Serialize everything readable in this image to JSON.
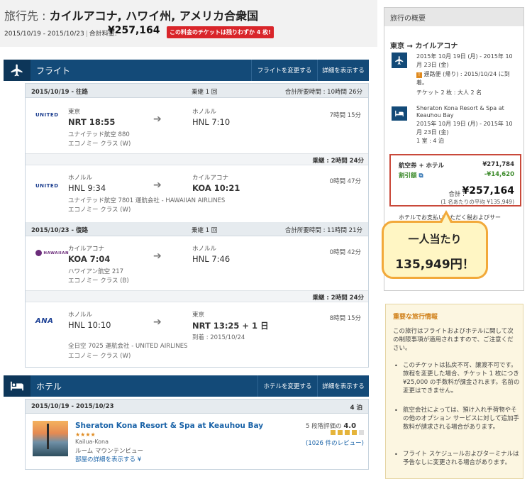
{
  "header": {
    "prefix": "旅行先 : ",
    "destination": "カイルアコナ, ハワイ州, アメリカ合衆国",
    "dates": "2015/10/19 - 2015/10/23",
    "total_label": "合計料金:",
    "total": "¥257,164",
    "badge": "この料金のチケットは残りわずか 4 枚!"
  },
  "flight_section": {
    "title": "フライト",
    "change_btn": "フライトを変更する",
    "details_btn": "詳細を表示する"
  },
  "outbound": {
    "date": "2015/10/19 - 往路",
    "stops": "乗継 1 回",
    "total_time": "合計所要時間 : 10時間 26分",
    "layover": "乗継 : 2時間 24分",
    "segments": [
      {
        "logo": "UNITED",
        "from_city": "東京",
        "from_time": "NRT 18:55",
        "airline": "ユナイテッド航空 880",
        "cabin": "エコノミー クラス (W)",
        "to_city": "ホノルル",
        "to_time": "HNL 7:10",
        "duration": "7時間 15分"
      },
      {
        "logo": "UNITED",
        "from_city": "ホノルル",
        "from_time": "HNL 9:34",
        "airline": "ユナイテッド航空 7801 運航会社 - HAWAIIAN AIRLINES",
        "cabin": "エコノミー クラス (W)",
        "to_city": "カイルアコナ",
        "to_time": "KOA 10:21",
        "duration": "0時間 47分"
      }
    ]
  },
  "inbound": {
    "date": "2015/10/23 - 復路",
    "stops": "乗継 1 回",
    "total_time": "合計所要時間 : 11時間 21分",
    "layover": "乗継 : 2時間 24分",
    "segments": [
      {
        "logo": "HAWAIIAN",
        "from_city": "カイルアコナ",
        "from_time": "KOA 7:04",
        "airline": "ハワイアン航空 217",
        "cabin": "エコノミー クラス (B)",
        "to_city": "ホノルル",
        "to_time": "HNL 7:46",
        "duration": "0時間 42分"
      },
      {
        "logo": "ANA",
        "from_city": "ホノルル",
        "from_time": "HNL 10:10",
        "airline": "全日空 7025 運航会社 - UNITED AIRLINES",
        "cabin": "エコノミー クラス (W)",
        "to_city": "東京",
        "to_time": "NRT 13:25 + 1 日",
        "arrival_note": "到着 : 2015/10/24",
        "duration": "8時間 15分"
      }
    ]
  },
  "hotel_section": {
    "title": "ホテル",
    "change_btn": "ホテルを変更する",
    "details_btn": "詳細を表示する",
    "dates": "2015/10/19 - 2015/10/23",
    "nights": "4 泊",
    "name": "Sheraton Kona Resort & Spa at Keauhou Bay",
    "stars": "★★★★",
    "location": "Kailua-Kona",
    "room": "ルーム マウンテンビュー",
    "room_link": "部屋の詳細を表示する ¥",
    "rating_label": "5 段階評価の",
    "rating": "4.0",
    "reviews": "(1026 件のレビュー)"
  },
  "summary": {
    "title": "旅行の概要",
    "route": "東京 → カイルアコナ",
    "flight_dates": "2015年 10月 19日 (月) - 2015年 10",
    "flight_dates2": "月 23日 (金)",
    "warning": "遅路便 (帰り) : 2015/10/24 に到",
    "warning2": "着。",
    "tickets": "チケット 2 枚 : 大人 2 名",
    "hotel_name": "Sheraton Kona Resort & Spa at",
    "hotel_name2": "Keauhou Bay",
    "hotel_dates": "2015年 10月 19日 (月) - 2015年 10",
    "hotel_dates2": "月 23日 (金)",
    "rooms": "1 室 : 4 泊",
    "airhotel_label": "航空券 + ホテル",
    "airhotel_value": "¥271,784",
    "discount_label": "割引額",
    "discount_value": "-¥14,620",
    "total_label": "合計 :",
    "total": "¥257,164",
    "per_person": "(1 名あたりの平均 ¥135,949)",
    "cutoff": "ホテルでお支払いいただく税およびサー"
  },
  "callout": {
    "line1": "一人当たり",
    "line2": "135,949円！"
  },
  "info": {
    "title": "重要な旅行情報",
    "intro": "この旅行はフライトおよびホテルに関して次の制限事項が適用されますので、ご注意ください。",
    "bullets": [
      "このチケットは払戻不可、譲渡不可です。旅程を変更した場合、チケット 1 枚につき ¥25,000 の手数料が課金されます。名前の変更はできません。",
      "航空会社によっては、預け入れ手荷物やその他のオプション サービスに対して追加手数料が請求される場合があります。",
      "フライト スケジュールおよびターミナルは予告なしに変更される場合があります。"
    ]
  },
  "colors": {
    "brand": "#134a78",
    "alert": "#d9252a",
    "callout_border": "#f2a93a"
  }
}
